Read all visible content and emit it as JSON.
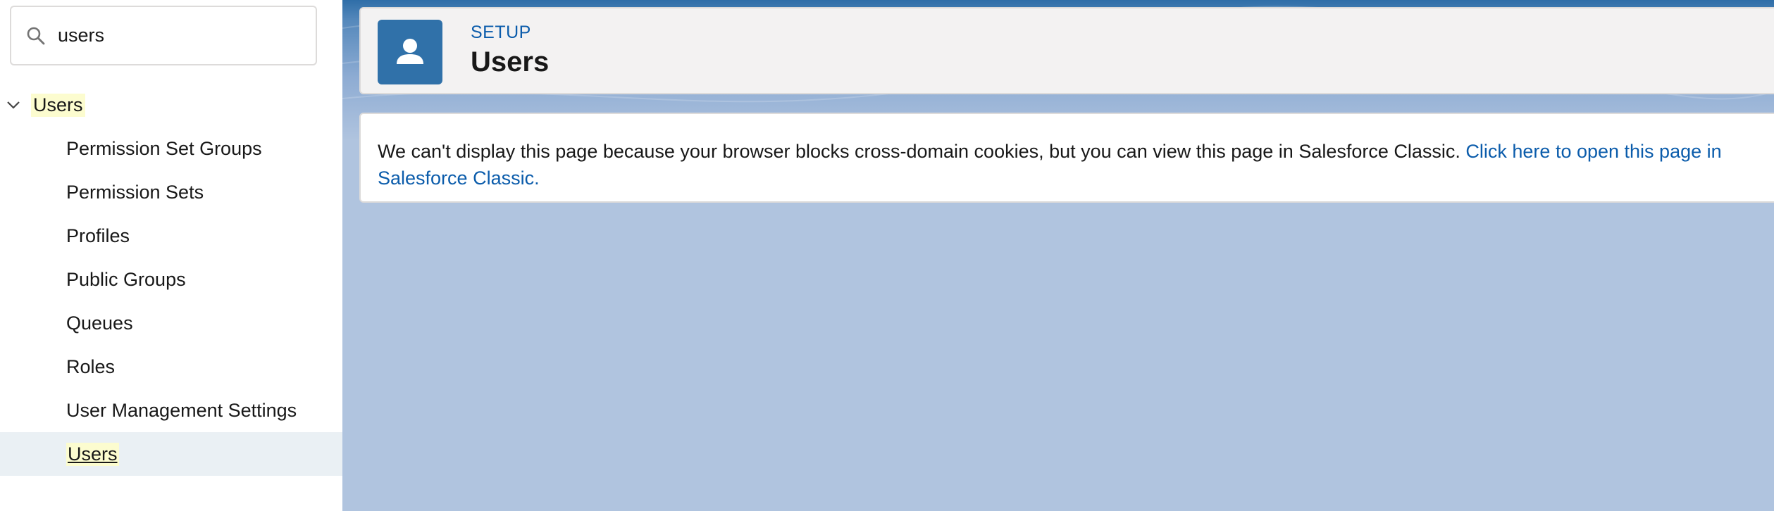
{
  "search": {
    "value": "users",
    "icon": "search-icon"
  },
  "tree": {
    "parent_label": "Users",
    "items": [
      {
        "label": "Permission Set Groups"
      },
      {
        "label": "Permission Sets"
      },
      {
        "label": "Profiles"
      },
      {
        "label": "Public Groups"
      },
      {
        "label": "Queues"
      },
      {
        "label": "Roles"
      },
      {
        "label": "User Management Settings"
      },
      {
        "label": "Users",
        "selected": true
      }
    ]
  },
  "header": {
    "breadcrumb": "SETUP",
    "title": "Users",
    "icon": "user-icon"
  },
  "message": {
    "text": "We can't display this page because your browser blocks cross-domain cookies, but you can view this page in Salesforce Classic. ",
    "link_text": "Click here to open this page in Salesforce Classic."
  },
  "colors": {
    "link": "#0b5cab",
    "icon_bg": "#3071a9",
    "highlight": "#fcfccf",
    "main_bg": "#b0c4df",
    "selected_bg": "#eaf0f4"
  }
}
